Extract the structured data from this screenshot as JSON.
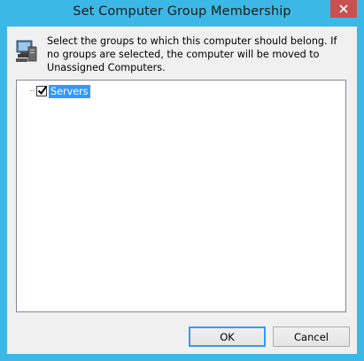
{
  "window": {
    "title": "Set Computer Group Membership",
    "accent_color": "#3cb8e6",
    "close_color": "#c75050"
  },
  "dialog": {
    "instruction": "Select the groups to which this computer should belong. If no groups are selected, the computer will be moved to Unassigned Computers.",
    "icon": "computer-icon"
  },
  "tree": {
    "items": [
      {
        "label": "Servers",
        "checked": true,
        "selected": true
      }
    ]
  },
  "buttons": {
    "ok_label": "OK",
    "cancel_label": "Cancel"
  }
}
